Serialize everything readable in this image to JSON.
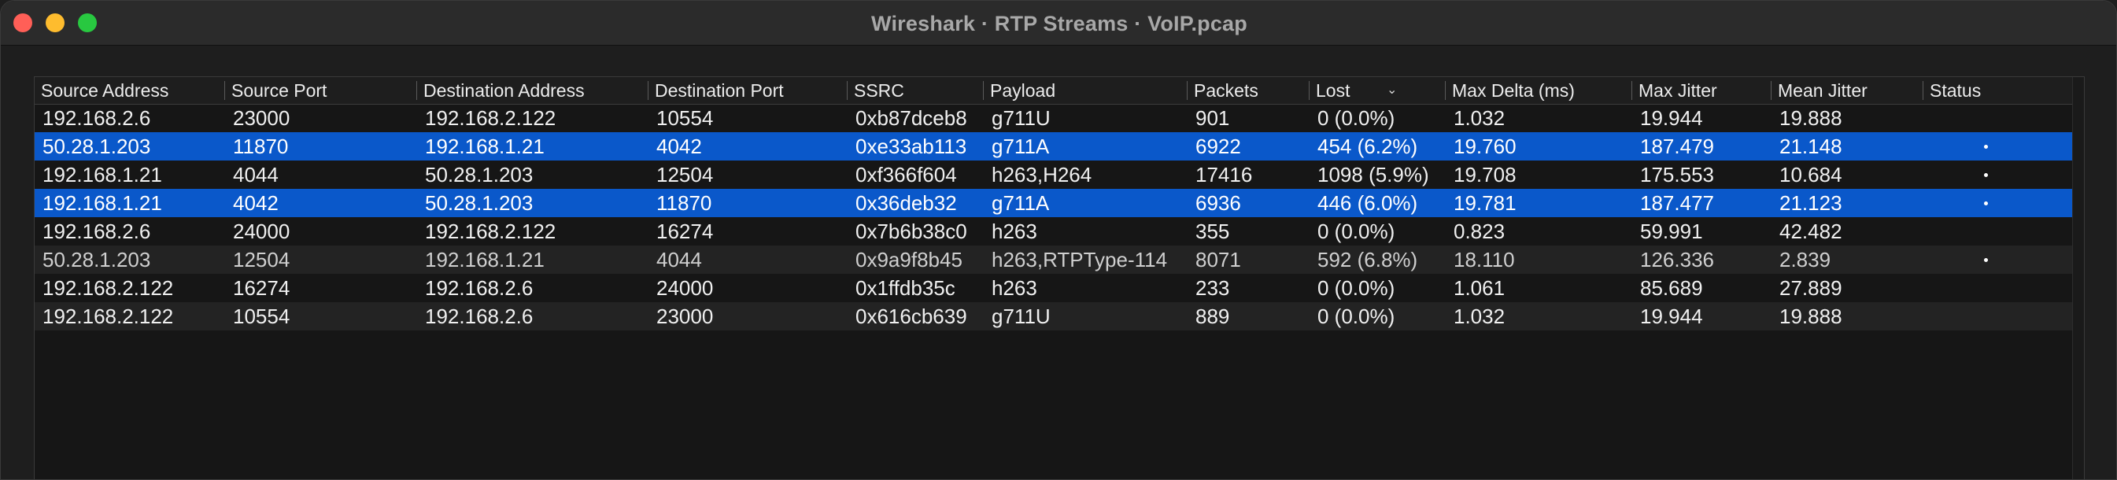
{
  "window": {
    "title": "Wireshark · RTP Streams · VoIP.pcap"
  },
  "table": {
    "columns": [
      "Source Address",
      "Source Port",
      "Destination Address",
      "Destination Port",
      "SSRC",
      "Payload",
      "Packets",
      "Lost",
      "Max Delta (ms)",
      "Max Jitter",
      "Mean Jitter",
      "Status"
    ],
    "sort_indicator": "⌄",
    "rows": [
      [
        "192.168.2.6",
        "23000",
        "192.168.2.122",
        "10554",
        "0xb87dceb8",
        "g711U",
        "901",
        "0 (0.0%)",
        "1.032",
        "19.944",
        "19.888",
        ""
      ],
      [
        "50.28.1.203",
        "11870",
        "192.168.1.21",
        "4042",
        "0xe33ab113",
        "g711A",
        "6922",
        "454 (6.2%)",
        "19.760",
        "187.479",
        "21.148",
        "•"
      ],
      [
        "192.168.1.21",
        "4044",
        "50.28.1.203",
        "12504",
        "0xf366f604",
        "h263,H264",
        "17416",
        "1098 (5.9%)",
        "19.708",
        "175.553",
        "10.684",
        "•"
      ],
      [
        "192.168.1.21",
        "4042",
        "50.28.1.203",
        "11870",
        "0x36deb32",
        "g711A",
        "6936",
        "446 (6.0%)",
        "19.781",
        "187.477",
        "21.123",
        "•"
      ],
      [
        "192.168.2.6",
        "24000",
        "192.168.2.122",
        "16274",
        "0x7b6b38c0",
        "h263",
        "355",
        "0 (0.0%)",
        "0.823",
        "59.991",
        "42.482",
        ""
      ],
      [
        "50.28.1.203",
        "12504",
        "192.168.1.21",
        "4044",
        "0x9a9f8b45",
        "h263,RTPType-114",
        "8071",
        "592 (6.8%)",
        "18.110",
        "126.336",
        "2.839",
        "•"
      ],
      [
        "192.168.2.122",
        "16274",
        "192.168.2.6",
        "24000",
        "0x1ffdb35c",
        "h263",
        "233",
        "0 (0.0%)",
        "1.061",
        "85.689",
        "27.889",
        ""
      ],
      [
        "192.168.2.122",
        "10554",
        "192.168.2.6",
        "23000",
        "0x616cb639",
        "g711U",
        "889",
        "0 (0.0%)",
        "1.032",
        "19.944",
        "19.888",
        ""
      ]
    ],
    "selected_rows": [
      1,
      3
    ],
    "colors": {
      "selection": "#0a58ca",
      "background": "#161616",
      "header": "#1e1e1e"
    }
  }
}
